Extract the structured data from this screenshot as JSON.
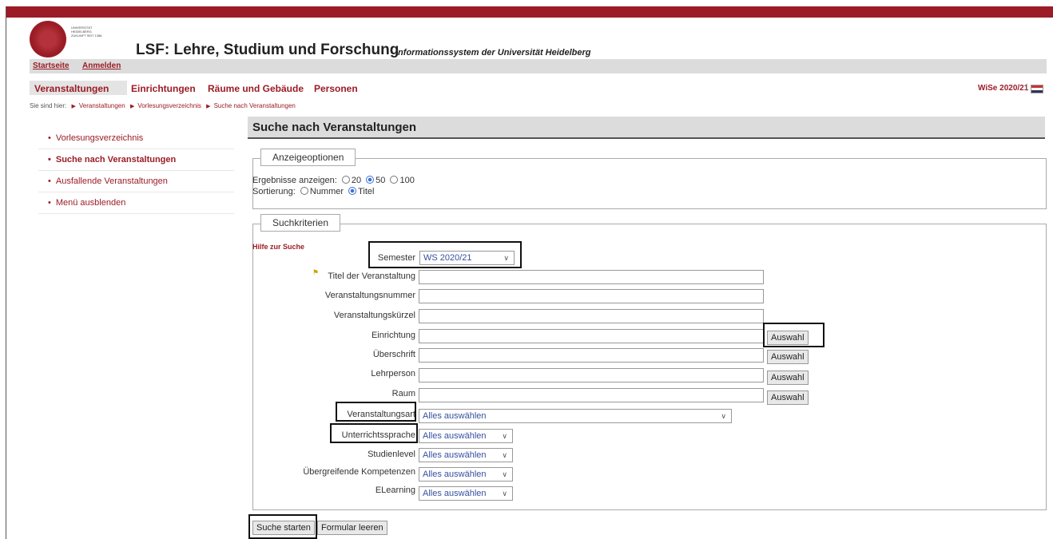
{
  "header": {
    "logo_text": "UNIVERSITÄT HEIDELBERG ZUKUNFT SEIT 1386",
    "title": "LSF: Lehre, Studium und Forschung",
    "subtitle": "Informationssystem der Universität Heidelberg"
  },
  "subnav": {
    "home": "Startseite",
    "login": "Anmelden"
  },
  "mainnav": {
    "items": [
      "Veranstaltungen",
      "Einrichtungen",
      "Räume und Gebäude",
      "Personen"
    ],
    "semester": "WiSe 2020/21",
    "separator": "|"
  },
  "breadcrumb": {
    "prefix": "Sie sind hier:",
    "items": [
      "Veranstaltungen",
      "Vorlesungsverzeichnis",
      "Suche nach Veranstaltungen"
    ]
  },
  "sidebar": {
    "items": [
      "Vorlesungsverzeichnis",
      "Suche nach Veranstaltungen",
      "Ausfallende Veranstaltungen",
      "Menü ausblenden"
    ]
  },
  "content": {
    "title": "Suche nach Veranstaltungen"
  },
  "display_options": {
    "legend": "Anzeigeoptionen",
    "results_label": "Ergebnisse anzeigen:",
    "results_options": [
      "20",
      "50",
      "100"
    ],
    "results_selected": "50",
    "sort_label": "Sortierung:",
    "sort_options": [
      "Nummer",
      "Titel"
    ],
    "sort_selected": "Titel"
  },
  "search": {
    "legend": "Suchkriterien",
    "help": "Hilfe zur Suche",
    "semester_label": "Semester",
    "semester_value": "WS 2020/21",
    "fields": {
      "title": "Titel der Veranstaltung",
      "number": "Veranstaltungsnummer",
      "short": "Veranstaltungskürzel",
      "institution": "Einrichtung",
      "heading": "Überschrift",
      "teacher": "Lehrperson",
      "room": "Raum"
    },
    "choose_label": "Auswahl",
    "selects": {
      "type_label": "Veranstaltungsart",
      "language_label": "Unterrichtssprache",
      "level_label": "Studienlevel",
      "competences_label": "Übergreifende Kompetenzen",
      "elearning_label": "ELearning",
      "all_value": "Alles auswählen"
    },
    "start_button": "Suche starten",
    "clear_button": "Formular leeren"
  },
  "colors": {
    "accent": "#9b1c26",
    "gray_bar": "#dcdcdc"
  }
}
